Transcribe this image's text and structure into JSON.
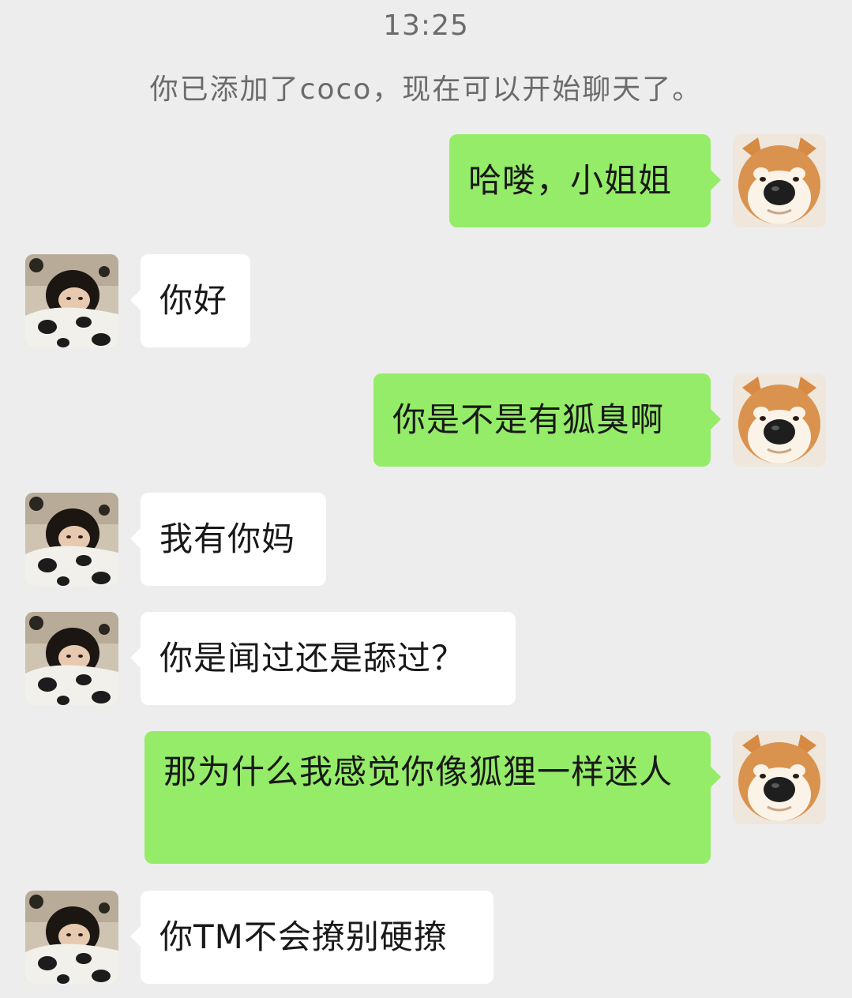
{
  "chat": {
    "timestamp": "13:25",
    "system_note": "你已添加了coco，现在可以开始聊天了。",
    "messages": [
      {
        "sender": "self",
        "text": "哈喽，小姐姐"
      },
      {
        "sender": "other",
        "text": "你好"
      },
      {
        "sender": "self",
        "text": "你是不是有狐臭啊"
      },
      {
        "sender": "other",
        "text": "我有你妈"
      },
      {
        "sender": "other",
        "text": "你是闻过还是舔过？"
      },
      {
        "sender": "self",
        "text": "那为什么我感觉你像狐狸一样迷人"
      },
      {
        "sender": "other",
        "text": "你TM不会撩别硬撩"
      }
    ]
  },
  "colors": {
    "background": "#ededed",
    "self_bubble": "#95ec69",
    "other_bubble": "#ffffff",
    "meta_text": "#6b6b6b"
  },
  "icons": {
    "self_avatar": "shiba-dog-avatar-icon",
    "other_avatar": "girl-with-pillow-avatar-icon"
  }
}
